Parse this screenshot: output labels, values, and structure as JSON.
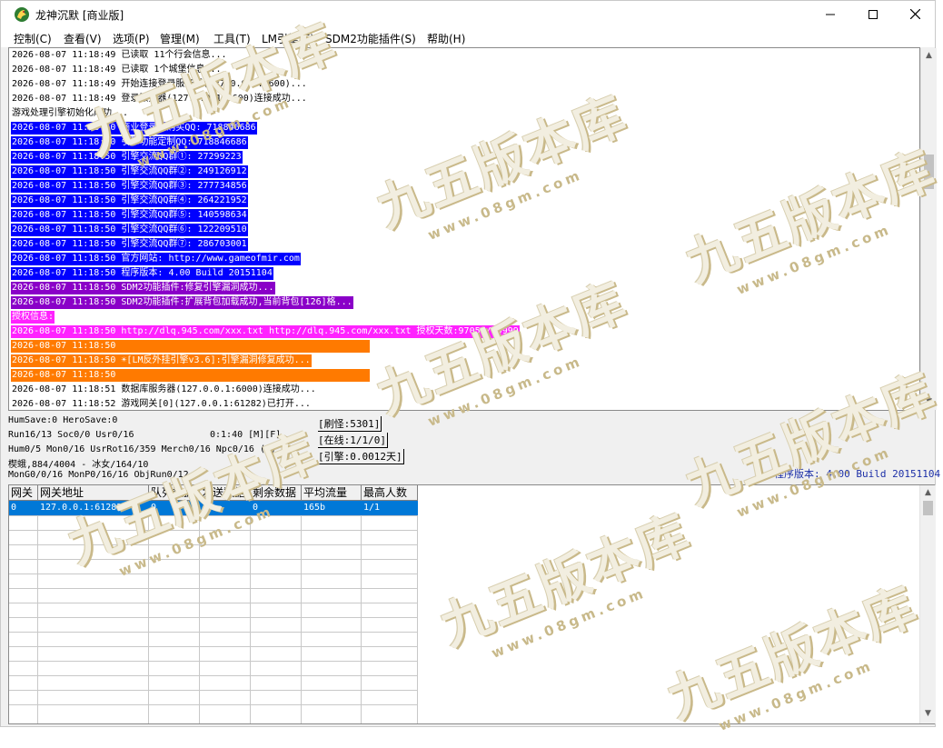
{
  "window": {
    "title": "龙神沉默 [商业版]"
  },
  "menu": [
    "控制(C)",
    "查看(V)",
    "选项(P)",
    "管理(M)",
    "工具(T)",
    "LM引擎(E)",
    "SDM2功能插件(S)",
    "帮助(H)"
  ],
  "log": [
    {
      "text": "2026-08-07 11:18:49 已读取 11个行会信息...",
      "bg": "",
      "fg": "#000000"
    },
    {
      "text": "2026-08-07 11:18:49 已读取 1个城堡信息...",
      "bg": "",
      "fg": "#000000"
    },
    {
      "text": "2026-08-07 11:18:49 开始连接登录服务器(127.0.0.1:5600)...",
      "bg": "",
      "fg": "#000000"
    },
    {
      "text": "2026-08-07 11:18:49 登录服务器(127.0.0.1:5600)连接成功...",
      "bg": "",
      "fg": "#000000"
    },
    {
      "text": "游戏处理引擎初始化成功...",
      "bg": "",
      "fg": "#000000"
    },
    {
      "text": "2026-08-07 11:18:50 商业登录器购买QQ: 718846686",
      "bg": "#0000ff",
      "fg": "#ffffff"
    },
    {
      "text": "2026-08-07 11:18:50 引擎功能定制QQ: 718846686",
      "bg": "#0000ff",
      "fg": "#ffffff"
    },
    {
      "text": "2026-08-07 11:18:50 引擎交流QQ群①: 27299223",
      "bg": "#0000ff",
      "fg": "#ffffff"
    },
    {
      "text": "2026-08-07 11:18:50 引擎交流QQ群②: 249126912",
      "bg": "#0000ff",
      "fg": "#ffffff"
    },
    {
      "text": "2026-08-07 11:18:50 引擎交流QQ群③: 277734856",
      "bg": "#0000ff",
      "fg": "#ffffff"
    },
    {
      "text": "2026-08-07 11:18:50 引擎交流QQ群④: 264221952",
      "bg": "#0000ff",
      "fg": "#ffffff"
    },
    {
      "text": "2026-08-07 11:18:50 引擎交流QQ群⑤: 140598634",
      "bg": "#0000ff",
      "fg": "#ffffff"
    },
    {
      "text": "2026-08-07 11:18:50 引擎交流QQ群⑥: 122209510",
      "bg": "#0000ff",
      "fg": "#ffffff"
    },
    {
      "text": "2026-08-07 11:18:50 引擎交流QQ群⑦: 286703001",
      "bg": "#0000ff",
      "fg": "#ffffff"
    },
    {
      "text": "2026-08-07 11:18:50 官方网站: http://www.gameofmir.com",
      "bg": "#0000ff",
      "fg": "#ffffff"
    },
    {
      "text": "2026-08-07 11:18:50 程序版本: 4.00 Build 20151104",
      "bg": "#0000ff",
      "fg": "#ffffff"
    },
    {
      "text": "2026-08-07 11:18:50 SDM2功能插件:修复引擎漏洞成功...",
      "bg": "#8a00c8",
      "fg": "#ffffff"
    },
    {
      "text": "2026-08-07 11:18:50 SDM2功能插件:扩展背包加载成功,当前背包[126]格...",
      "bg": "#8a00c8",
      "fg": "#ffffff"
    },
    {
      "text": "授权信息:",
      "bg": "#ff22ff",
      "fg": "#ffffff"
    },
    {
      "text": "2026-08-07 11:18:50 http://dlq.945.com/xxx.txt http://dlq.945.com/xxx.txt 授权天数:97055/99999",
      "bg": "#ff22ff",
      "fg": "#ffffff"
    },
    {
      "text": "2026-08-07 11:18:50",
      "bg": "#ff7a00",
      "fg": "#ffffff",
      "bar": true
    },
    {
      "text": "2026-08-07 11:18:50 ☀[LM反外挂引擎v3.6]:引擎漏洞修复成功...",
      "bg": "#ff7a00",
      "fg": "#ffffff"
    },
    {
      "text": "2026-08-07 11:18:50",
      "bg": "#ff7a00",
      "fg": "#ffffff",
      "bar": true
    },
    {
      "text": "2026-08-07 11:18:51 数据库服务器(127.0.0.1:6000)连接成功...",
      "bg": "",
      "fg": "#000000"
    },
    {
      "text": "2026-08-07 11:18:52 游戏网关[0](127.0.0.1:61282)已打开...",
      "bg": "",
      "fg": "#000000"
    }
  ],
  "status": {
    "line1": "HumSave:0 HeroSave:0",
    "line2": "Run16/13 Soc0/0 Usr0/16",
    "time": "0:1:40 [M][F]",
    "line3": "Hum0/5 Mon0/16 UsrRot16/359 Merch0/16 Npc0/16 (0)",
    "line4": "楔蛾,884/4004 - 冰女/164/10",
    "line5": "MonG0/0/16 MonP0/16/16 ObjRun0/12",
    "refresh": "[刷怪:5301]",
    "online": "[在线:1/1/0]",
    "engine": "[引擎:0.0012天]",
    "version": "程序版本: 4.00 Build 20151104"
  },
  "grid": {
    "headers": [
      "网关",
      "网关地址",
      "队列数据",
      "发送数据",
      "剩余数据",
      "平均流量",
      "最高人数"
    ],
    "rows": [
      [
        "0",
        "127.0.0.1:61282",
        "0",
        "4",
        "0",
        "165b",
        "1/1"
      ]
    ]
  },
  "watermark": {
    "text": "九五版本库",
    "url": "www.08gm.com"
  },
  "colors": {
    "selection": "#0078d7",
    "version_text": "#1c2fa7"
  }
}
